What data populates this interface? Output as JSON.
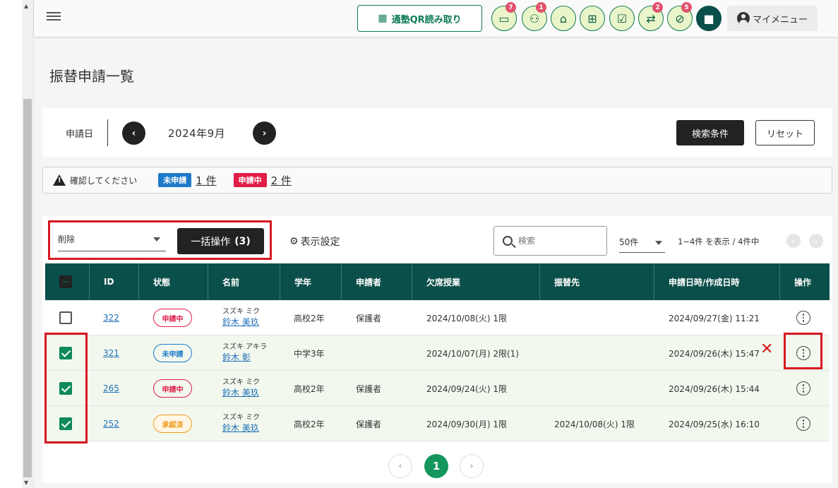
{
  "header": {
    "qr_label": "通塾QR読み取り",
    "badges": {
      "messages": "7",
      "people": "1",
      "transfer": "2",
      "cancel": "5"
    },
    "my_menu": "マイメニュー"
  },
  "page": {
    "title": "振替申請一覧"
  },
  "filter": {
    "label": "申請日",
    "month": "2024年9月",
    "search_condition": "検索条件",
    "reset": "リセット"
  },
  "alert": {
    "text": "確認してください",
    "tag_unapplied": "未申請",
    "count_unapplied": "1 件",
    "tag_applying": "申請中",
    "count_applying": "2 件"
  },
  "toolbar": {
    "bulk_action_value": "削除",
    "bulk_button_label": "一括操作",
    "bulk_button_count": "(3)",
    "display_settings": "表示設定",
    "search_placeholder": "検索",
    "per_page": "50件",
    "range_text": "1~4件 を表示 / 4件中"
  },
  "table": {
    "headers": [
      "ID",
      "状態",
      "名前",
      "学年",
      "申請者",
      "欠席授業",
      "振替先",
      "申請日時/作成日時",
      "操作"
    ],
    "rows": [
      {
        "id": "322",
        "status": "申請中",
        "kana": "スズキ ミク",
        "name": "鈴木 美玖",
        "grade": "高校2年",
        "applicant": "保護者",
        "absent": "2024/10/08(火) 1限",
        "transfer": "",
        "created": "2024/09/27(金) 11:21"
      },
      {
        "id": "321",
        "status": "未申請",
        "kana": "スズキ アキラ",
        "name": "鈴木 彰",
        "grade": "中学3年",
        "applicant": "",
        "absent": "2024/10/07(月) 2限(1)",
        "transfer": "",
        "created": "2024/09/26(木) 15:47"
      },
      {
        "id": "265",
        "status": "申請中",
        "kana": "スズキ ミク",
        "name": "鈴木 美玖",
        "grade": "高校2年",
        "applicant": "保護者",
        "absent": "2024/09/24(火) 1限",
        "transfer": "",
        "created": "2024/09/26(木) 15:44"
      },
      {
        "id": "252",
        "status": "承認済",
        "kana": "スズキ ミク",
        "name": "鈴木 美玖",
        "grade": "高校2年",
        "applicant": "保護者",
        "absent": "2024/09/30(月) 1限",
        "transfer": "2024/10/08(火) 1限",
        "created": "2024/09/25(水) 16:10"
      }
    ]
  },
  "pagination": {
    "current": "1"
  },
  "colors": {
    "primary": "#0b4f4a",
    "accent": "#14965c",
    "highlight": "#d71920"
  }
}
